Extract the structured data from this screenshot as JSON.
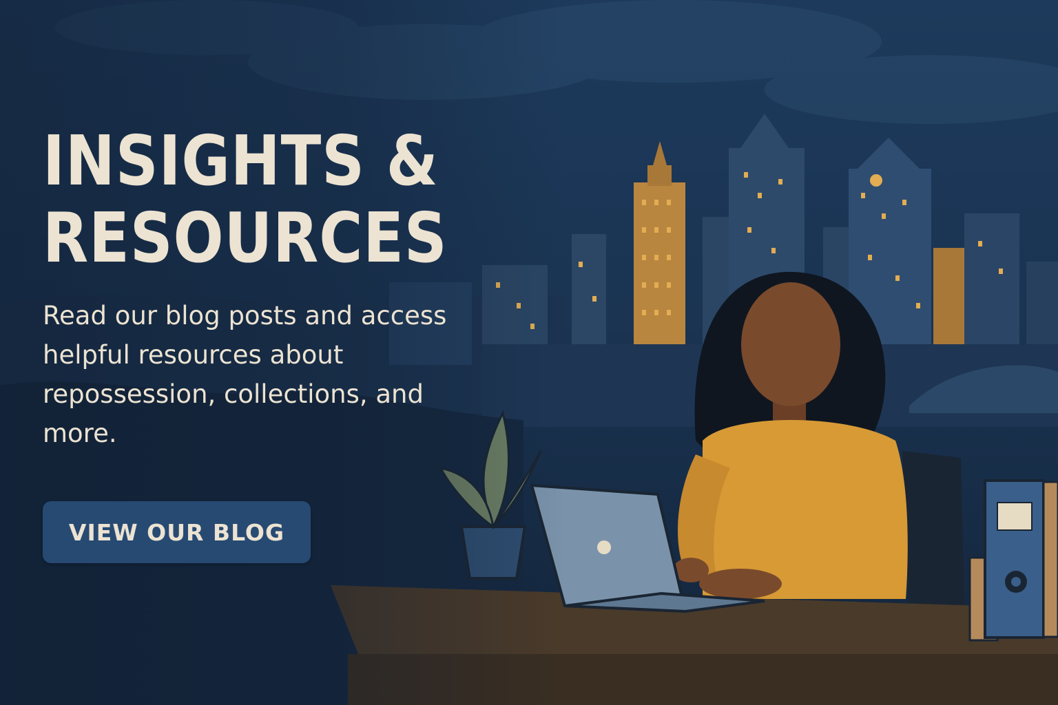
{
  "hero": {
    "headline_line1": "INSIGHTS &",
    "headline_line2": "RESOURCES",
    "subtext": "Read our blog posts and access helpful resources about repossession, collections, and more.",
    "cta_label": "VIEW OUR BLOG"
  },
  "colors": {
    "text": "#ece3d2",
    "button": "#274a73",
    "sky": "#1d3a5c",
    "shirt": "#d79a35",
    "window_light": "#e2ad53"
  },
  "illustration": {
    "icons": [
      "city-skyline-icon",
      "woman-icon",
      "laptop-icon",
      "plant-icon",
      "binder-icon",
      "desk-icon"
    ]
  }
}
